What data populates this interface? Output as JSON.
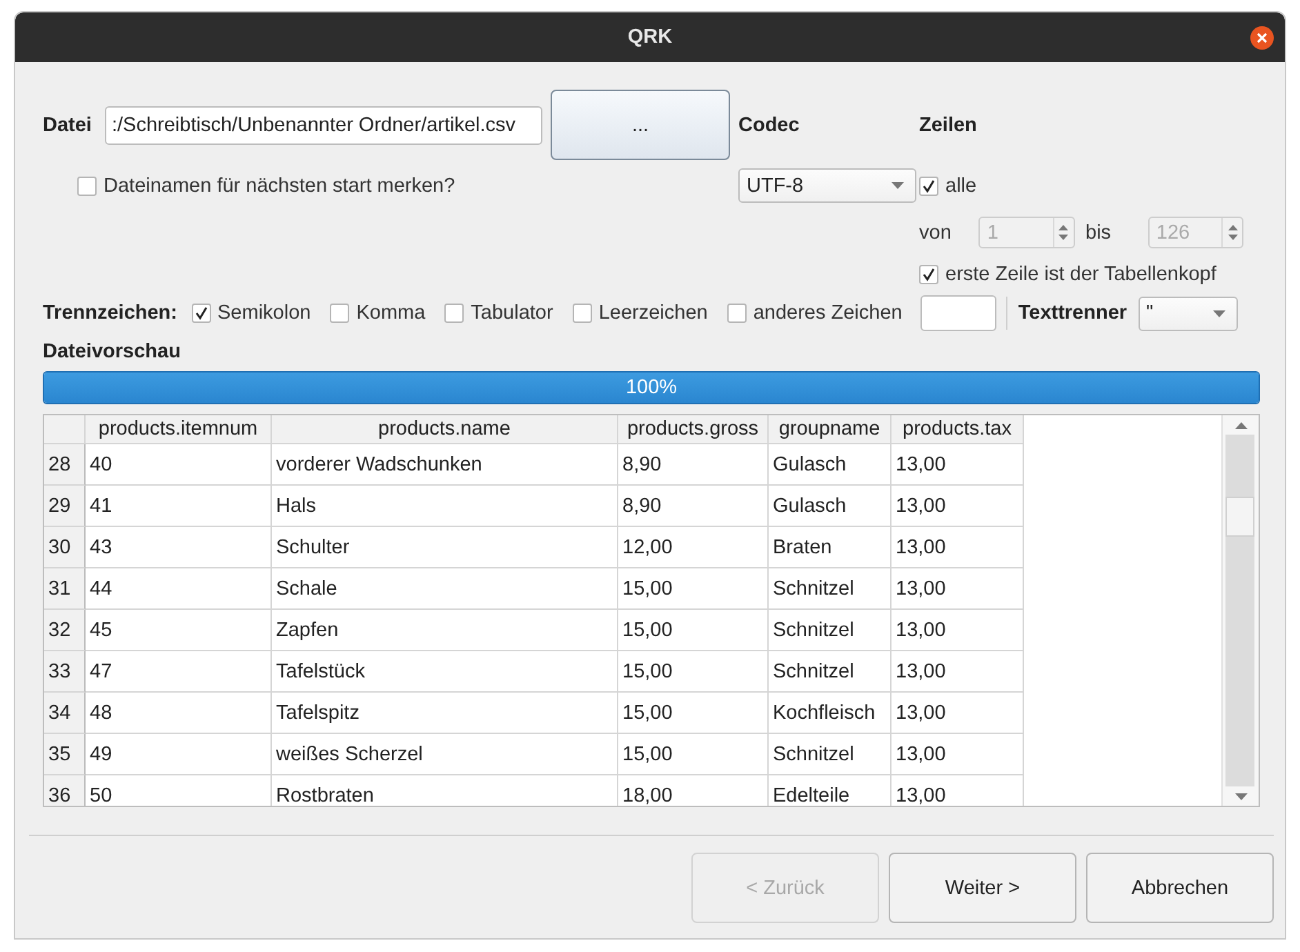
{
  "window": {
    "title": "QRK"
  },
  "file": {
    "label": "Datei",
    "value": ":/Schreibtisch/Unbenannter Ordner/artikel.csv",
    "browse_button": "...",
    "remember": {
      "label": "Dateinamen für nächsten start merken?",
      "checked": false
    }
  },
  "codec": {
    "label": "Codec",
    "value": "UTF-8"
  },
  "lines": {
    "label": "Zeilen",
    "all": {
      "label": "alle",
      "checked": true
    },
    "from_label": "von",
    "from_value": "1",
    "to_label": "bis",
    "to_value": "126",
    "range_disabled": true,
    "header_row": {
      "label": "erste Zeile ist der Tabellenkopf",
      "checked": true
    }
  },
  "separators": {
    "label": "Trennzeichen:",
    "options": [
      {
        "label": "Semikolon",
        "checked": true
      },
      {
        "label": "Komma",
        "checked": false
      },
      {
        "label": "Tabulator",
        "checked": false
      },
      {
        "label": "Leerzeichen",
        "checked": false
      },
      {
        "label": "anderes Zeichen",
        "checked": false
      }
    ],
    "text_delimiter": {
      "label": "Texttrenner",
      "value": "\""
    }
  },
  "preview": {
    "label": "Dateivorschau",
    "progress": {
      "level": 1,
      "text": "100%"
    },
    "table": {
      "columns": [
        "products.itemnum",
        "products.name",
        "products.gross",
        "groupname",
        "products.tax"
      ],
      "rows": [
        {
          "number": "28",
          "cells": [
            "40",
            "vorderer Wadschunken",
            "8,90",
            "Gulasch",
            "13,00"
          ]
        },
        {
          "number": "29",
          "cells": [
            "41",
            "Hals",
            "8,90",
            "Gulasch",
            "13,00"
          ]
        },
        {
          "number": "30",
          "cells": [
            "43",
            "Schulter",
            "12,00",
            "Braten",
            "13,00"
          ]
        },
        {
          "number": "31",
          "cells": [
            "44",
            "Schale",
            "15,00",
            "Schnitzel",
            "13,00"
          ]
        },
        {
          "number": "32",
          "cells": [
            "45",
            "Zapfen",
            "15,00",
            "Schnitzel",
            "13,00"
          ]
        },
        {
          "number": "33",
          "cells": [
            "47",
            "Tafelstück",
            "15,00",
            "Schnitzel",
            "13,00"
          ]
        },
        {
          "number": "34",
          "cells": [
            "48",
            "Tafelspitz",
            "15,00",
            "Kochfleisch",
            "13,00"
          ]
        },
        {
          "number": "35",
          "cells": [
            "49",
            "weißes Scherzel",
            "15,00",
            "Schnitzel",
            "13,00"
          ]
        },
        {
          "number": "36",
          "cells": [
            "50",
            "Rostbraten",
            "18,00",
            "Edelteile",
            "13,00"
          ]
        }
      ]
    }
  },
  "buttons": [
    {
      "label": "< Zurück",
      "disabled": true
    },
    {
      "label": "Weiter >",
      "disabled": false
    },
    {
      "label": "Abbrechen",
      "disabled": false
    }
  ]
}
